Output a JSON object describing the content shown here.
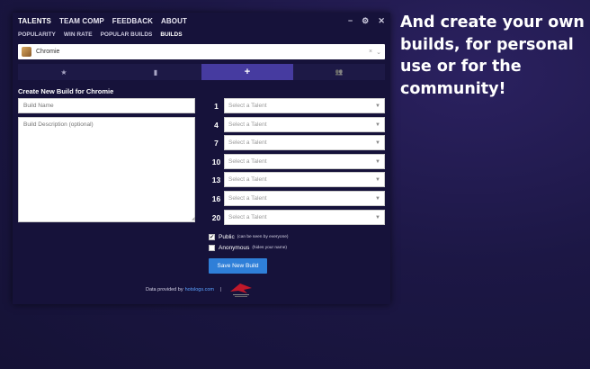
{
  "top_nav": [
    "TALENTS",
    "TEAM COMP",
    "FEEDBACK",
    "ABOUT"
  ],
  "window_controls": {
    "minimize": "−",
    "settings": "⚙",
    "close": "✕"
  },
  "sub_nav": [
    "POPULARITY",
    "WIN RATE",
    "POPULAR BUILDS",
    "BUILDS"
  ],
  "hero": {
    "name": "Chromie",
    "clear": "×",
    "dropdown": "⌄",
    "avatar_icon": "chromie-portrait-icon"
  },
  "tabs": [
    {
      "icon": "star-icon",
      "glyph": "★"
    },
    {
      "icon": "book-icon",
      "glyph": "▮"
    },
    {
      "icon": "plus-icon",
      "glyph": "+"
    },
    {
      "icon": "community-icon",
      "glyph": "👥"
    }
  ],
  "form": {
    "title": "Create New Build for Chromie",
    "name_placeholder": "Build Name",
    "desc_placeholder": "Build Description (optional)"
  },
  "talents": [
    {
      "level": "1",
      "placeholder": "Select a Talent"
    },
    {
      "level": "4",
      "placeholder": "Select a Talent"
    },
    {
      "level": "7",
      "placeholder": "Select a Talent"
    },
    {
      "level": "10",
      "placeholder": "Select a Talent"
    },
    {
      "level": "13",
      "placeholder": "Select a Talent"
    },
    {
      "level": "16",
      "placeholder": "Select a Talent"
    },
    {
      "level": "20",
      "placeholder": "Select a Talent"
    }
  ],
  "options": {
    "public_label": "Public",
    "public_note": "(can be seen by everyone)",
    "public_checked": true,
    "anon_label": "Anonymous",
    "anon_note": "(hides your name)",
    "anon_checked": false
  },
  "save_label": "Save New Build",
  "footer": {
    "prefix": "Data provided by",
    "link": "hotslogs.com",
    "separator": "|",
    "logo_icon": "rog-logo-icon"
  },
  "caption": "And create your own builds, for personal use or for the community!",
  "colors": {
    "accent": "#463ba0",
    "button": "#2f7fd8",
    "link": "#5aa2ff"
  }
}
